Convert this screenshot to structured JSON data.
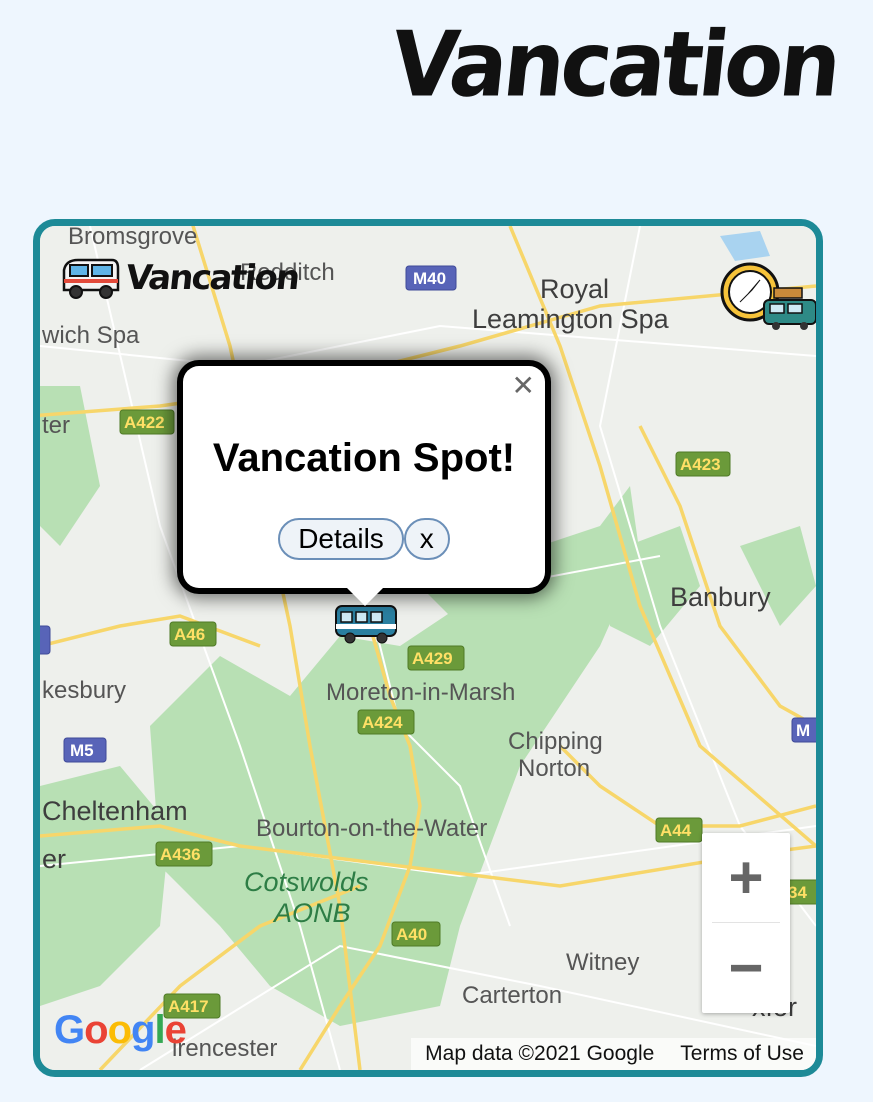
{
  "app": {
    "title": "Vancation"
  },
  "map": {
    "brand_label": "Vancation",
    "popup": {
      "title": "Vancation Spot!",
      "details_label": "Details",
      "close_label": "x",
      "dismiss_glyph": "✕"
    },
    "zoom": {
      "in_label": "+",
      "out_label": "−"
    },
    "attribution": {
      "data_label": "Map data ©2021 Google",
      "terms_label": "Terms of Use"
    },
    "google_logo": "Google",
    "places": [
      "Bromsgrove",
      "Redditch",
      "Royal",
      "Leamington Spa",
      "wich Spa",
      "ter",
      "Banbury",
      "kesbury",
      "Moreton-in-Marsh",
      "Chipping",
      "Norton",
      "Cheltenham",
      "Bourton-on-the-Water",
      "er",
      "Cotswolds",
      "AONB",
      "Witney",
      "Carterton",
      "irencester",
      "xfor"
    ],
    "roads": [
      "M40",
      "A422",
      "A423",
      "A46",
      "A429",
      "A424",
      "M5",
      "A44",
      "A436",
      "A40",
      "A417",
      "M",
      "34"
    ],
    "icons": [
      "van-icon",
      "compass-icon",
      "bus-marker-icon",
      "car-trip-icon"
    ]
  }
}
